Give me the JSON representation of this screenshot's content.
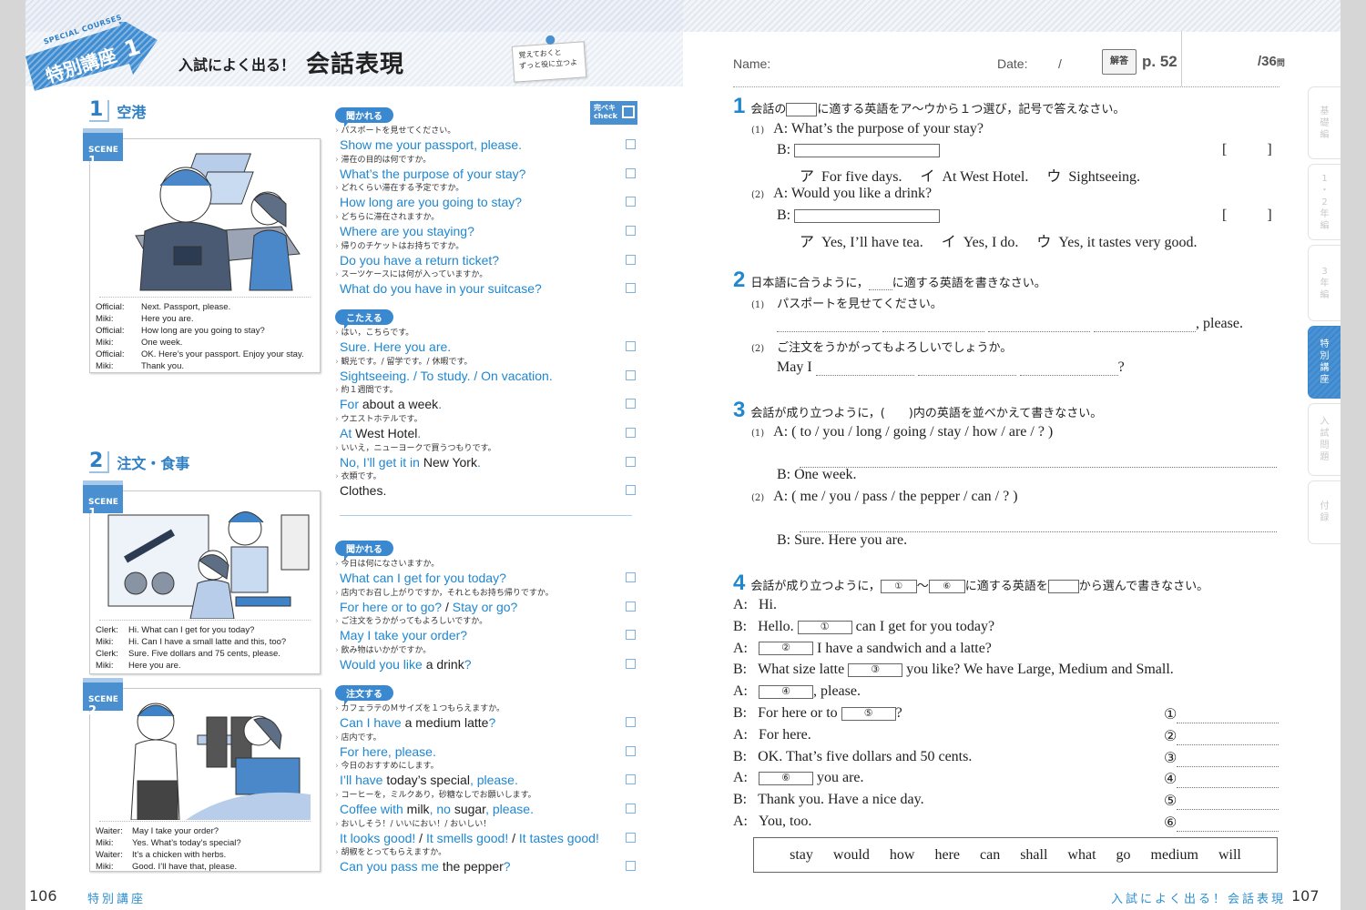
{
  "left": {
    "header": {
      "series_label": "SPECIAL COURSES",
      "badge": "特別講座",
      "badge_number": "1",
      "subtitle": "入試によく出る！",
      "title": "会話表現",
      "memo_line1": "覚えておくと",
      "memo_line2": "ずっと役に立つよ"
    },
    "check_label_ja": "完ペキ",
    "check_label_en": "check",
    "sections": [
      {
        "number": "1",
        "title": "空港",
        "scenes": [
          {
            "tag": "SCENE",
            "tag_number": "1",
            "illustration": "airport passport control",
            "dialog": [
              {
                "speaker": "Official:",
                "line": "Next.  Passport, please."
              },
              {
                "speaker": "Miki:",
                "line": "Here you are."
              },
              {
                "speaker": "Official:",
                "line": "How long are you going to stay?"
              },
              {
                "speaker": "Miki:",
                "line": "One week."
              },
              {
                "speaker": "Official:",
                "line": "OK.  Here’s your passport.  Enjoy your stay."
              },
              {
                "speaker": "Miki:",
                "line": "Thank you."
              }
            ]
          }
        ]
      },
      {
        "number": "2",
        "title": "注文・食事",
        "scenes": [
          {
            "tag": "SCENE",
            "tag_number": "1",
            "illustration": "cafe counter",
            "dialog": [
              {
                "speaker": "Clerk:",
                "line": "Hi.  What can I get for you today?"
              },
              {
                "speaker": "Miki:",
                "line": "Hi.  Can I have a small latte and this, too?"
              },
              {
                "speaker": "Clerk:",
                "line": "Sure.  Five dollars and 75 cents, please."
              },
              {
                "speaker": "Miki:",
                "line": "Here you are."
              }
            ]
          },
          {
            "tag": "SCENE",
            "tag_number": "2",
            "illustration": "restaurant waiter",
            "dialog": [
              {
                "speaker": "Waiter:",
                "line": "May I take your order?"
              },
              {
                "speaker": "Miki:",
                "line": "Yes.  What’s today’s special?"
              },
              {
                "speaker": "Waiter:",
                "line": "It’s a chicken with herbs."
              },
              {
                "speaker": "Miki:",
                "line": "Good.  I’ll have that, please."
              }
            ]
          }
        ]
      }
    ],
    "phrase_groups": [
      {
        "label": "聞かれる",
        "items": [
          {
            "ja": "パスポートを見せてください。",
            "en": "Show me your passport, please.",
            "checked": false
          },
          {
            "ja": "滞在の目的は何ですか。",
            "en": "What’s the purpose of your stay?",
            "checked": false
          },
          {
            "ja": "どれくらい滞在する予定ですか。",
            "en": "How long are you going to stay?",
            "checked": false
          },
          {
            "ja": "どちらに滞在されますか。",
            "en": "Where are you staying?",
            "checked": false
          },
          {
            "ja": "帰りのチケットはお持ちですか。",
            "en": "Do you have a return ticket?",
            "checked": false
          },
          {
            "ja": "スーツケースには何が入っていますか。",
            "en": "What do you have in your suitcase?",
            "checked": false
          }
        ]
      },
      {
        "label": "こたえる",
        "items": [
          {
            "ja": "はい，こちらです。",
            "en": "Sure.  Here you are.",
            "checked": false
          },
          {
            "ja": "観光です。/ 留学です。/ 休暇です。",
            "en": "Sightseeing. / To study. / On vacation.",
            "checked": false
          },
          {
            "ja": "約１週間です。",
            "en_parts": [
              {
                "t": "For ",
                "k": false
              },
              {
                "t": "about a week",
                "k": true
              },
              {
                "t": ".",
                "k": false
              }
            ],
            "checked": false
          },
          {
            "ja": "ウエストホテルです。",
            "en_parts": [
              {
                "t": "At ",
                "k": false
              },
              {
                "t": "West Hotel",
                "k": true
              },
              {
                "t": ".",
                "k": false
              }
            ],
            "checked": false
          },
          {
            "ja": "いいえ，ニューヨークで買うつもりです。",
            "en_parts": [
              {
                "t": "No, I’ll get it in ",
                "k": false
              },
              {
                "t": "New York",
                "k": true
              },
              {
                "t": ".",
                "k": false
              }
            ],
            "checked": false
          },
          {
            "ja": "衣類です。",
            "en_parts": [
              {
                "t": "Clothes.",
                "k": true
              }
            ],
            "checked": false
          }
        ]
      },
      {
        "label": "聞かれる",
        "items": [
          {
            "ja": "今日は何になさいますか。",
            "en": "What can I get for you today?",
            "checked": false
          },
          {
            "ja": "店内でお召し上がりですか，それともお持ち帰りですか。",
            "en_parts": [
              {
                "t": "For here or to go? ",
                "k": false
              },
              {
                "t": "/",
                "k": true
              },
              {
                "t": " Stay or go?",
                "k": false
              }
            ],
            "checked": false
          },
          {
            "ja": "ご注文をうかがってもよろしいですか。",
            "en": "May I take your order?",
            "checked": false
          },
          {
            "ja": "飲み物はいかがですか。",
            "en_parts": [
              {
                "t": "Would you like ",
                "k": false
              },
              {
                "t": "a drink",
                "k": true
              },
              {
                "t": "?",
                "k": false
              }
            ],
            "checked": false
          }
        ]
      },
      {
        "label": "注文する",
        "items": [
          {
            "ja": "カフェラテのＭサイズを１つもらえますか。",
            "en_parts": [
              {
                "t": "Can I have ",
                "k": false
              },
              {
                "t": "a medium latte",
                "k": true
              },
              {
                "t": "?",
                "k": false
              }
            ],
            "checked": false
          },
          {
            "ja": "店内です。",
            "en": "For here, please.",
            "checked": false
          },
          {
            "ja": "今日のおすすめにします。",
            "en_parts": [
              {
                "t": "I’ll have ",
                "k": false
              },
              {
                "t": "today’s special",
                "k": true
              },
              {
                "t": ", please.",
                "k": false
              }
            ],
            "checked": false
          },
          {
            "ja": "コーヒーを，ミルクあり，砂糖なしでお願いします。",
            "en_parts": [
              {
                "t": "Coffee with ",
                "k": false
              },
              {
                "t": "milk",
                "k": true
              },
              {
                "t": ", no ",
                "k": false
              },
              {
                "t": "sugar",
                "k": true
              },
              {
                "t": ", please.",
                "k": false
              }
            ],
            "checked": false
          },
          {
            "ja": "おいしそう！/ いいにおい！/ おいしい！",
            "en_parts": [
              {
                "t": "It looks good! ",
                "k": false
              },
              {
                "t": "/",
                "k": true
              },
              {
                "t": " It smells good! ",
                "k": false
              },
              {
                "t": "/",
                "k": true
              },
              {
                "t": " It tastes good!",
                "k": false
              }
            ],
            "checked": false
          },
          {
            "ja": "胡椒をとってもらえますか。",
            "en_parts": [
              {
                "t": "Can you pass me ",
                "k": false
              },
              {
                "t": "the pepper",
                "k": true
              },
              {
                "t": "?",
                "k": false
              }
            ],
            "checked": false
          }
        ]
      }
    ],
    "footer": {
      "page_number": "106",
      "label": "特別講座"
    }
  },
  "right": {
    "header": {
      "name_label": "Name:",
      "date_label": "Date:",
      "date_sep": "/",
      "answer_label": "解答",
      "answer_page": "p. 52",
      "score": "/36",
      "score_unit": "問"
    },
    "q1": {
      "number": "1",
      "instruction_pre": "会話の",
      "instruction_post": "に適する英語をア〜ウから１つ選び，記号で答えなさい。",
      "items": [
        {
          "n": "(1)",
          "a": "What’s the purpose of your stay?",
          "choices": [
            {
              "k": "ア",
              "t": "For five days."
            },
            {
              "k": "イ",
              "t": "At West Hotel."
            },
            {
              "k": "ウ",
              "t": "Sightseeing."
            }
          ]
        },
        {
          "n": "(2)",
          "a": "Would you like a drink?",
          "choices": [
            {
              "k": "ア",
              "t": "Yes, I’ll have tea."
            },
            {
              "k": "イ",
              "t": "Yes, I do."
            },
            {
              "k": "ウ",
              "t": "Yes, it tastes very good."
            }
          ]
        }
      ],
      "a_label": "A:",
      "b_label": "B:",
      "bracket_open": "[",
      "bracket_close": "]"
    },
    "q2": {
      "number": "2",
      "instruction_pre": "日本語に合うように，",
      "instruction_post": "に適する英語を書きなさい。",
      "items": [
        {
          "n": "(1)",
          "ja": "パスポートを見せてください。",
          "prefix": "",
          "suffix": ", please."
        },
        {
          "n": "(2)",
          "ja": "ご注文をうかがってもよろしいでしょうか。",
          "prefix": "May I",
          "suffix": "?"
        }
      ]
    },
    "q3": {
      "number": "3",
      "instruction": "会話が成り立つように，(　　)内の英語を並べかえて書きなさい。",
      "items": [
        {
          "n": "(1)",
          "a": "( to / you / long / going / stay / how / are / ? )",
          "b": "One week."
        },
        {
          "n": "(2)",
          "a": "( me / you / pass / the pepper / can / ? )",
          "b": "Sure.  Here you are."
        }
      ]
    },
    "q4": {
      "number": "4",
      "instruction_pre": "会話が成り立つように，",
      "instruction_from": "①",
      "instruction_tilde": "〜",
      "instruction_to": "⑥",
      "instruction_mid": "に適する英語を",
      "instruction_post": "から選んで書きなさい。",
      "dialog": [
        {
          "s": "A:",
          "pre": "Hi.",
          "blank": "",
          "post": ""
        },
        {
          "s": "B:",
          "pre": "Hello. ",
          "blank": "①",
          "post": " can I get for you today?"
        },
        {
          "s": "A:",
          "pre": "",
          "blank": "②",
          "post": " I have a sandwich and a latte?"
        },
        {
          "s": "B:",
          "pre": "What size latte ",
          "blank": "③",
          "post": " you like?  We have Large, Medium and Small."
        },
        {
          "s": "A:",
          "pre": "",
          "blank": "④",
          "post": ", please."
        },
        {
          "s": "B:",
          "pre": "For here or to ",
          "blank": "⑤",
          "post": "?"
        },
        {
          "s": "A:",
          "pre": "For here.",
          "blank": "",
          "post": ""
        },
        {
          "s": "B:",
          "pre": "OK. That’s five dollars and 50 cents.",
          "blank": "",
          "post": ""
        },
        {
          "s": "A:",
          "pre": "",
          "blank": "⑥",
          "post": " you are."
        },
        {
          "s": "B:",
          "pre": "Thank you.  Have a nice day.",
          "blank": "",
          "post": ""
        },
        {
          "s": "A:",
          "pre": "You, too.",
          "blank": "",
          "post": ""
        }
      ],
      "answer_labels": [
        "①",
        "②",
        "③",
        "④",
        "⑤",
        "⑥"
      ],
      "word_bank": [
        "stay",
        "would",
        "how",
        "here",
        "can",
        "shall",
        "what",
        "go",
        "medium",
        "will"
      ]
    },
    "footer": {
      "label": "入試によく出る！会話表現",
      "page_number": "107"
    }
  },
  "side_tabs": [
    {
      "label": "基礎編",
      "active": false
    },
    {
      "label": "1・2年編",
      "active": false
    },
    {
      "label": "3年編",
      "active": false
    },
    {
      "label": "特別講座",
      "active": true
    },
    {
      "label": "入試問題",
      "active": false
    },
    {
      "label": "付録",
      "active": false
    }
  ]
}
